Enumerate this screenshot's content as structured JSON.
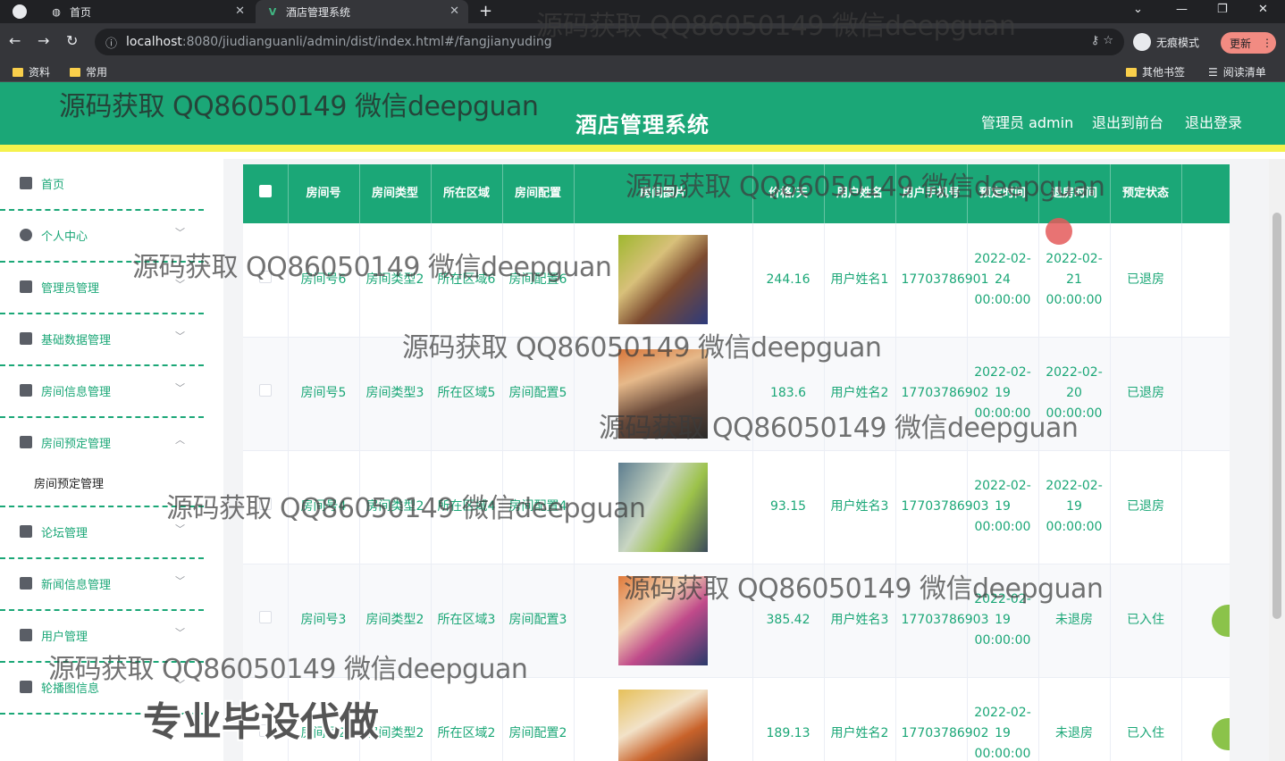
{
  "browser": {
    "tabs": [
      {
        "title": "首页",
        "active": false
      },
      {
        "title": "酒店管理系统",
        "active": true
      }
    ],
    "url_host": "localhost",
    "url_rest": ":8080/jiudianguanli/admin/dist/index.html#/fangjianyuding",
    "incognito_label": "无痕模式",
    "update_label": "更新",
    "bookmarks": [
      "资料",
      "常用"
    ],
    "bookmarks_right": [
      "其他书签",
      "阅读清单"
    ]
  },
  "header": {
    "title": "酒店管理系统",
    "links": [
      "管理员 admin",
      "退出到前台",
      "退出登录"
    ]
  },
  "sidebar": {
    "items": [
      {
        "label": "首页",
        "icon": "home-icon",
        "expandable": false
      },
      {
        "label": "个人中心",
        "icon": "user-icon",
        "expandable": true
      },
      {
        "label": "管理员管理",
        "icon": "admin-icon",
        "expandable": true
      },
      {
        "label": "基础数据管理",
        "icon": "chat-icon",
        "expandable": true
      },
      {
        "label": "房间信息管理",
        "icon": "grid-icon",
        "expandable": true
      },
      {
        "label": "房间预定管理",
        "icon": "briefcase-icon",
        "expandable": true,
        "expanded": true
      },
      {
        "label": "论坛管理",
        "icon": "forum-icon",
        "expandable": true
      },
      {
        "label": "新闻信息管理",
        "icon": "news-icon",
        "expandable": true
      },
      {
        "label": "用户管理",
        "icon": "sliders-icon",
        "expandable": true
      },
      {
        "label": "轮播图信息",
        "icon": "carousel-icon",
        "expandable": true
      }
    ],
    "submenu_label": "房间预定管理"
  },
  "table": {
    "columns": [
      "房间号",
      "房间类型",
      "所在区域",
      "房间配置",
      "房间图片",
      "价格/天",
      "用户姓名",
      "用户手机号",
      "预定时间",
      "退房时间",
      "预定状态"
    ],
    "rows": [
      {
        "room": "房间号6",
        "type": "房间类型2",
        "area": "所在区域6",
        "config": "房间配置6",
        "price": "244.16",
        "user": "用户姓名1",
        "phone": "17703786901",
        "book": "2022-02-24 00:00:00",
        "checkout": "2022-02-21 00:00:00",
        "status": "已退房"
      },
      {
        "room": "房间号5",
        "type": "房间类型3",
        "area": "所在区域5",
        "config": "房间配置5",
        "price": "183.6",
        "user": "用户姓名2",
        "phone": "17703786902",
        "book": "2022-02-19 00:00:00",
        "checkout": "2022-02-20 00:00:00",
        "status": "已退房"
      },
      {
        "room": "房间号4",
        "type": "房间类型2",
        "area": "所在区域4",
        "config": "房间配置4",
        "price": "93.15",
        "user": "用户姓名3",
        "phone": "17703786903",
        "book": "2022-02-19 00:00:00",
        "checkout": "2022-02-19 00:00:00",
        "status": "已退房"
      },
      {
        "room": "房间号3",
        "type": "房间类型2",
        "area": "所在区域3",
        "config": "房间配置3",
        "price": "385.42",
        "user": "用户姓名3",
        "phone": "17703786903",
        "book": "2022-02-19 00:00:00",
        "checkout": "未退房",
        "status": "已入住"
      },
      {
        "room": "房间号2",
        "type": "房间类型2",
        "area": "所在区域2",
        "config": "房间配置2",
        "price": "189.13",
        "user": "用户姓名2",
        "phone": "17703786902",
        "book": "2022-02-19 00:00:00",
        "checkout": "未退房",
        "status": "已入住"
      }
    ]
  },
  "watermark": {
    "text": "源码获取 QQ86050149 微信deepguan",
    "big": "专业毕设代做"
  },
  "colors": {
    "primary": "#1ba777",
    "header_border": "#f5f24c"
  }
}
